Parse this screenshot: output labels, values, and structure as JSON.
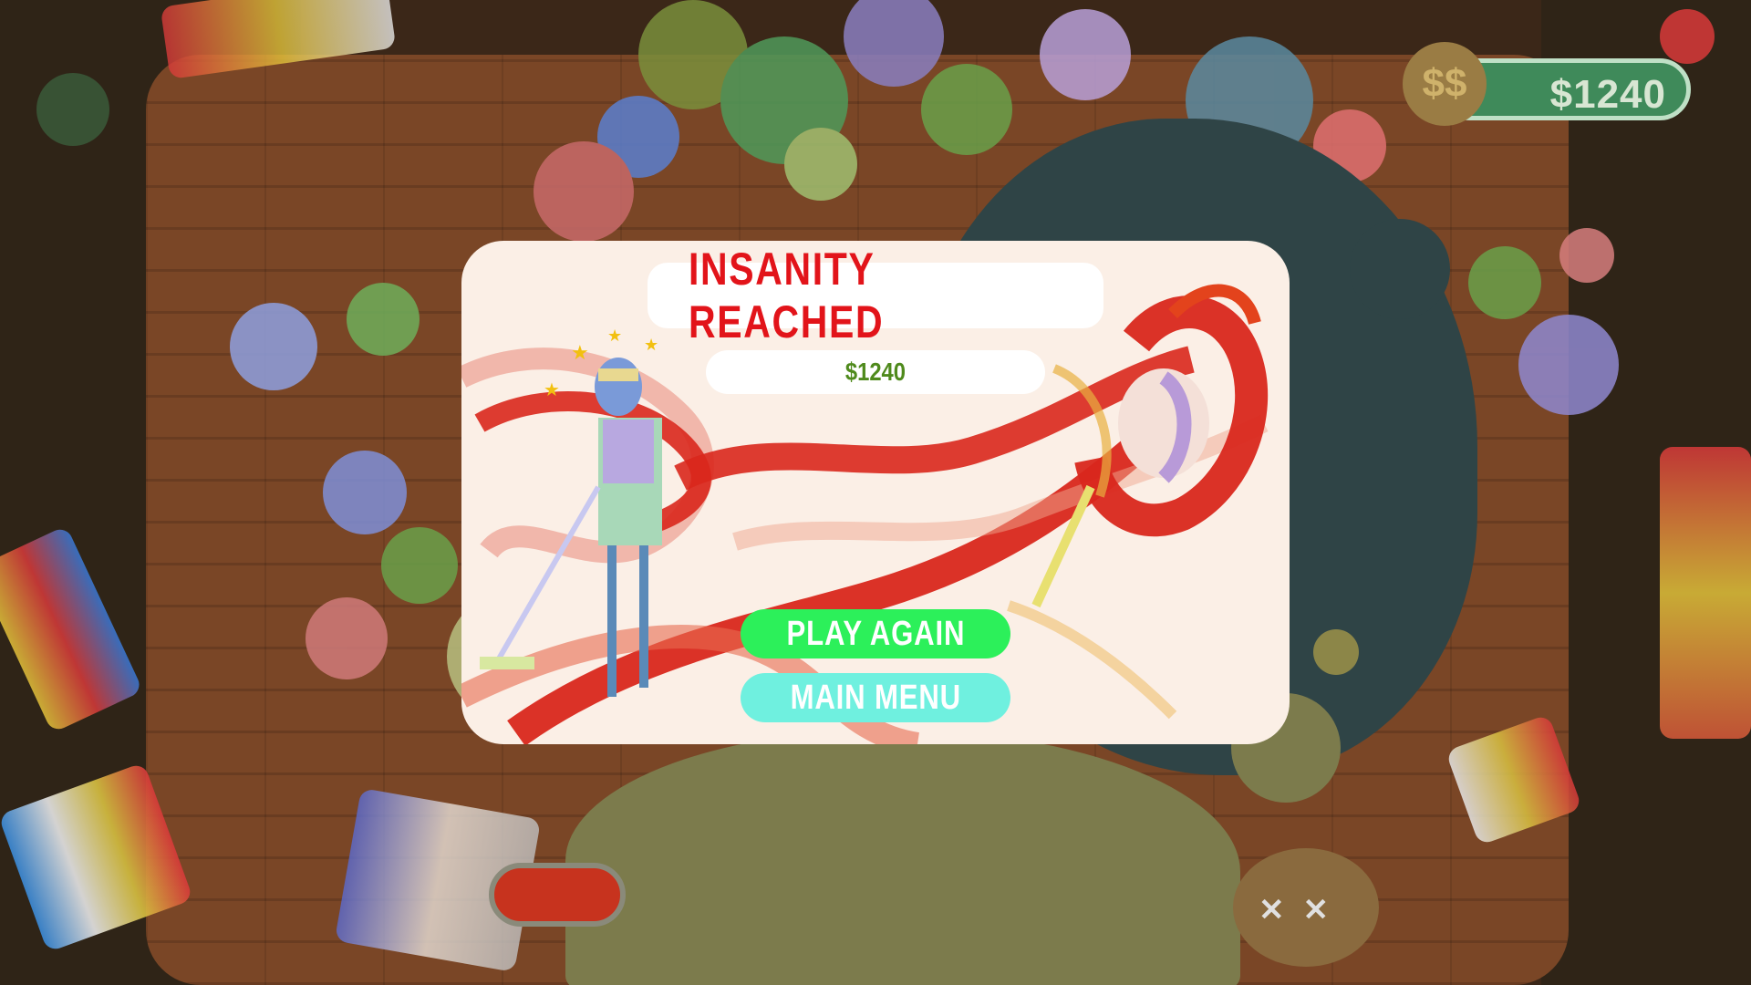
{
  "hud": {
    "money": "$1240",
    "money_icon": "money-bag-icon"
  },
  "modal": {
    "title": "INSANITY REACHED",
    "amount": "$1240",
    "play_again_label": "PLAY AGAIN",
    "main_menu_label": "MAIN MENU"
  },
  "colors": {
    "title_red": "#e2141a",
    "amount_green": "#4f8a1c",
    "play_button": "#2cf05a",
    "menu_button": "#6ff0df",
    "hud_pill": "#3f8a5a"
  }
}
